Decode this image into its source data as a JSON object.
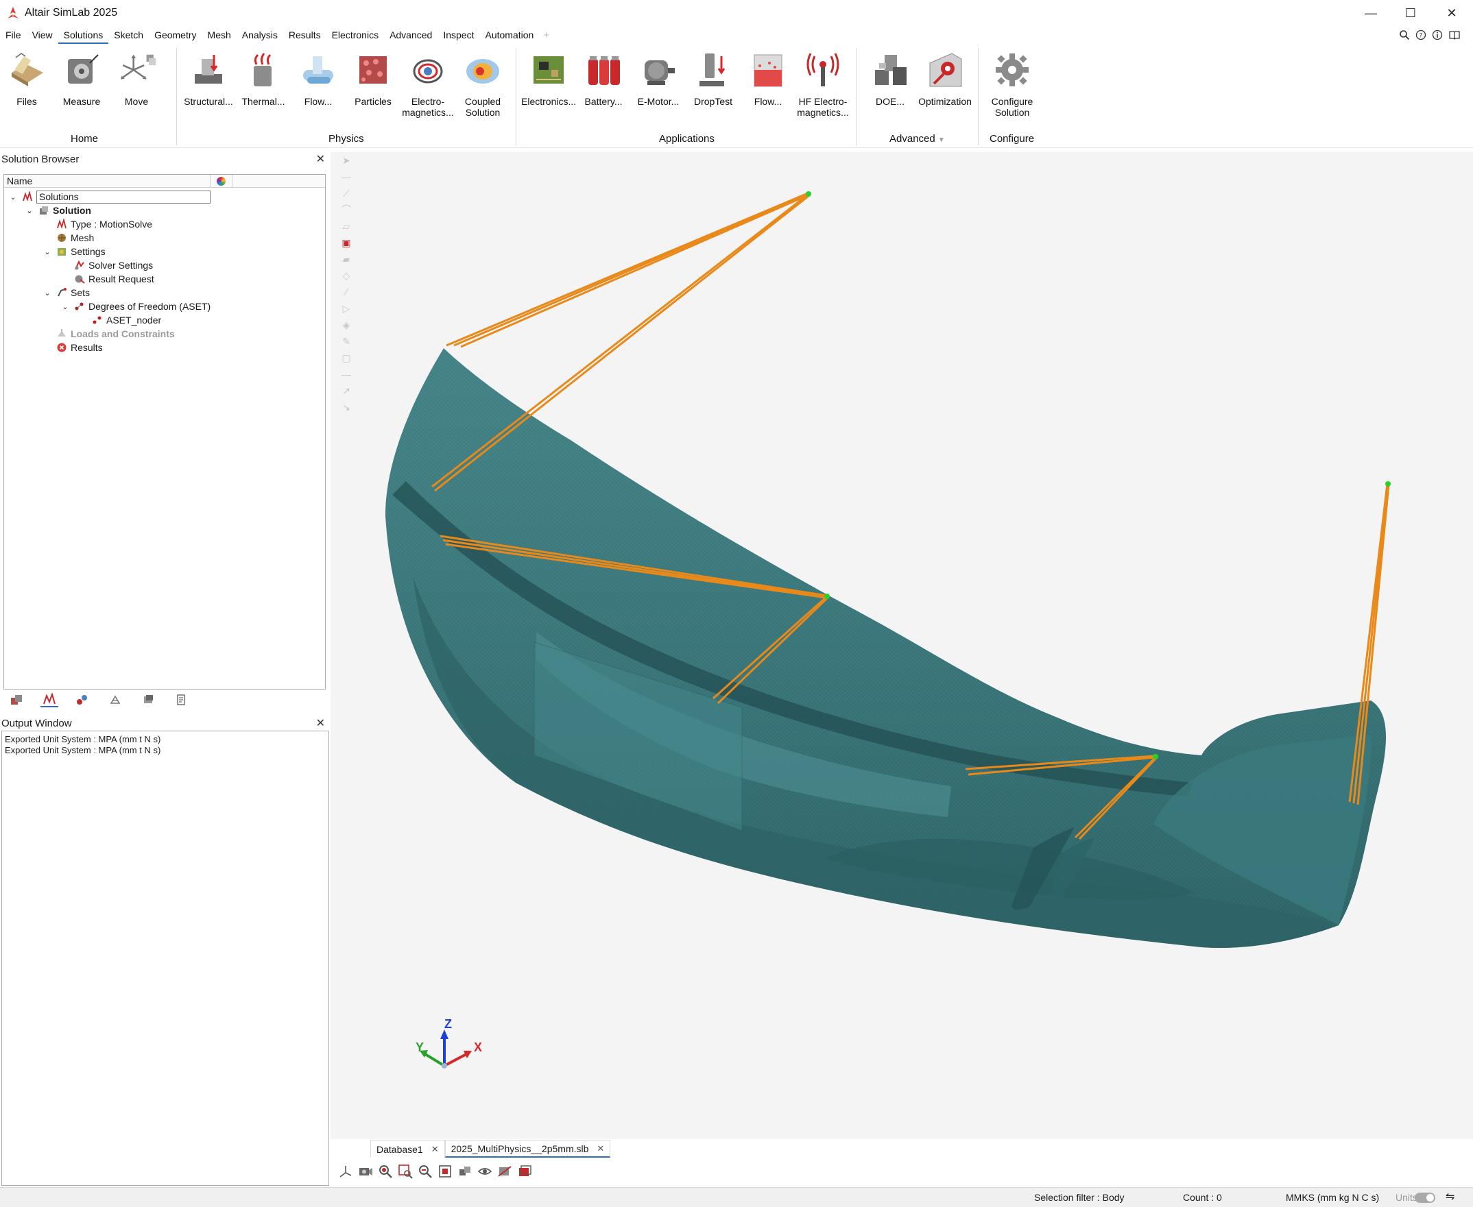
{
  "window": {
    "title": "Altair SimLab 2025",
    "minimize": "—",
    "maximize": "☐",
    "close": "✕"
  },
  "menu": {
    "items": [
      "File",
      "View",
      "Solutions",
      "Sketch",
      "Geometry",
      "Mesh",
      "Analysis",
      "Results",
      "Electronics",
      "Advanced",
      "Inspect",
      "Automation"
    ],
    "active": "Solutions",
    "plus": "+"
  },
  "ribbon": {
    "tools": {
      "files": "Files",
      "measure": "Measure",
      "move": "Move",
      "structural": "Structural...",
      "thermal": "Thermal...",
      "flow": "Flow...",
      "particles": "Particles",
      "electromagnetics_1": "Electro-",
      "electromagnetics_2": "magnetics...",
      "coupled_1": "Coupled",
      "coupled_2": "Solution",
      "electronics": "Electronics...",
      "battery": "Battery...",
      "emotor": "E-Motor...",
      "droptest": "DropTest",
      "flow_app": "Flow...",
      "hf_1": "HF Electro-",
      "hf_2": "magnetics...",
      "doe": "DOE...",
      "optimization": "Optimization",
      "configure_1": "Configure",
      "configure_2": "Solution"
    },
    "groups": {
      "home": "Home",
      "physics": "Physics",
      "applications": "Applications",
      "advanced": "Advanced",
      "advanced_arrow": "▼",
      "configure": "Configure"
    }
  },
  "solution_browser": {
    "title": "Solution Browser",
    "close": "✕",
    "column_name": "Name",
    "tree": {
      "root": "Solutions",
      "solution": "Solution",
      "type": "Type : MotionSolve",
      "mesh": "Mesh",
      "settings": "Settings",
      "solver_settings": "Solver Settings",
      "result_request": "Result Request",
      "sets": "Sets",
      "dof": "Degrees of Freedom (ASET)",
      "aset": "ASET_noder",
      "loads": "Loads and Constraints",
      "results": "Results"
    },
    "expand_glyph": "⌄"
  },
  "output_window": {
    "title": "Output Window",
    "close": "✕",
    "lines": [
      "Exported Unit System : MPA (mm t N s)",
      "Exported Unit System : MPA (mm t N s)"
    ]
  },
  "viewport": {
    "axis_x": "X",
    "axis_y": "Y",
    "axis_z": "Z",
    "colors": {
      "background": "#f4f4f4",
      "model": "#3f7f83",
      "connector": "#e8891a",
      "node": "#2bd12b"
    }
  },
  "doc_tabs": [
    {
      "label": "Database1",
      "close": "✕"
    },
    {
      "label": "2025_MultiPhysics__2p5mm.slb",
      "close": "✕"
    }
  ],
  "status": {
    "selection_filter": "Selection filter : Body",
    "count": "Count : 0",
    "units": "MMKS (mm kg N C s)",
    "units_label": "Units",
    "menu_glyph": "⇋"
  }
}
